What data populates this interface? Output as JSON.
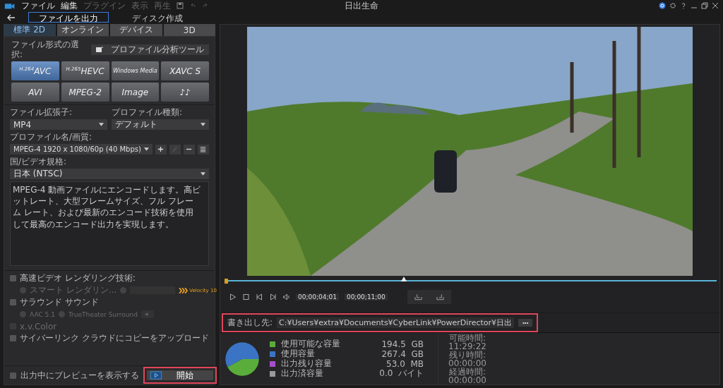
{
  "menu": [
    {
      "label": "ファイル",
      "disabled": false
    },
    {
      "label": "編集",
      "disabled": false
    },
    {
      "label": "プラグイン",
      "disabled": true
    },
    {
      "label": "表示",
      "disabled": true
    },
    {
      "label": "再生",
      "disabled": true
    }
  ],
  "window": {
    "title": "日出生命"
  },
  "mode_tabs": [
    {
      "label": "ファイルを出力",
      "selected": true
    },
    {
      "label": "ディスク作成",
      "selected": false
    }
  ],
  "tabs": [
    {
      "label": "標準 2D",
      "selected": true
    },
    {
      "label": "オンライン",
      "selected": false
    },
    {
      "label": "デバイス",
      "selected": false
    },
    {
      "label": "3D",
      "selected": false
    }
  ],
  "format_label": "ファイル形式の選択:",
  "profile_tool_button": "プロファイル分析ツール",
  "formats": [
    {
      "sup": "H.264",
      "label": "AVC",
      "selected": true
    },
    {
      "sup": "H.265",
      "label": "HEVC",
      "selected": false
    },
    {
      "label": "Windows Media",
      "selected": false
    },
    {
      "label": "XAVC S",
      "selected": false
    },
    {
      "label": "AVI",
      "selected": false
    },
    {
      "label": "MPEG-2",
      "selected": false
    },
    {
      "label": "Image",
      "selected": false
    },
    {
      "label": "♪♪",
      "selected": false
    }
  ],
  "extension": {
    "label": "ファイル拡張子:",
    "value": "MP4"
  },
  "profile_type": {
    "label": "プロファイル種類:",
    "value": "デフォルト"
  },
  "profile": {
    "label": "プロファイル名/画質:",
    "value": "MPEG-4 1920 x 1080/60p (40 Mbps)",
    "buttons": [
      {
        "kind": "add",
        "disabled": false
      },
      {
        "kind": "edit",
        "disabled": true
      },
      {
        "kind": "remove",
        "disabled": false
      },
      {
        "kind": "list",
        "disabled": false
      }
    ]
  },
  "region": {
    "label": "国/ビデオ規格:",
    "value": "日本 (NTSC)"
  },
  "description": "MPEG-4 動画ファイルにエンコードします。高ビットレート、大型フレームサイズ、フル フレーム レート、および最新のエンコード技術を使用して最高のエンコード出力を実現します。",
  "rendering": {
    "label": "高速ビデオ レンダリング技術:",
    "checked": false,
    "radios": [
      {
        "label": "スマート レンダリン...",
        "selected": false
      },
      {
        "selected": false
      }
    ],
    "logo_text": "Velocity 10"
  },
  "surround": {
    "label": "サラウンド サウンド",
    "checked": false,
    "radios": [
      {
        "label": "AAC 5.1",
        "selected": false
      },
      {
        "label": "TrueTheater Surround",
        "selected": false
      }
    ]
  },
  "xv_color": {
    "label": "x.v.Color",
    "checked": false,
    "disabled": true
  },
  "cloud_upload": {
    "label": "サイバーリンク クラウドにコピーをアップロード",
    "checked": false
  },
  "show_preview": {
    "label": "出力中にプレビューを表示する",
    "checked": false
  },
  "start_button": {
    "label": "開始",
    "highlighted": true
  },
  "timeline": {
    "level": 0.36
  },
  "timecodes": [
    "00;00;04;01",
    "00;00;11;00"
  ],
  "output": {
    "label": "書き出し先:",
    "path": "C:¥Users¥extra¥Documents¥CyberLink¥PowerDirector¥日出",
    "browse": "•••",
    "highlighted": true
  },
  "disk_chart": {
    "chart_data": {
      "type": "pie",
      "categories": [
        "使用可能な容量",
        "使用容量"
      ],
      "series": [
        {
          "values": [
            42.1,
            57.9
          ]
        }
      ]
    }
  },
  "legend": [
    {
      "value": "194.5  GB",
      "color": "#5aad3a"
    },
    {
      "value": "267.4  GB",
      "color": "#3b74c4"
    },
    {
      "label": "出力残り容量",
      "value": "53.0  MB",
      "color": "#a64fc9"
    },
    {
      "label": "出力済容量",
      "value": "0.0  バイト",
      "color": "#9a9a9a"
    }
  ],
  "times": [
    {
      "label": "可能時間:",
      "value": "11:29:22"
    },
    {
      "label": "残り時間:",
      "value": "00:00:00"
    },
    {
      "label": "経過時間:",
      "value": "00:00:00"
    }
  ]
}
